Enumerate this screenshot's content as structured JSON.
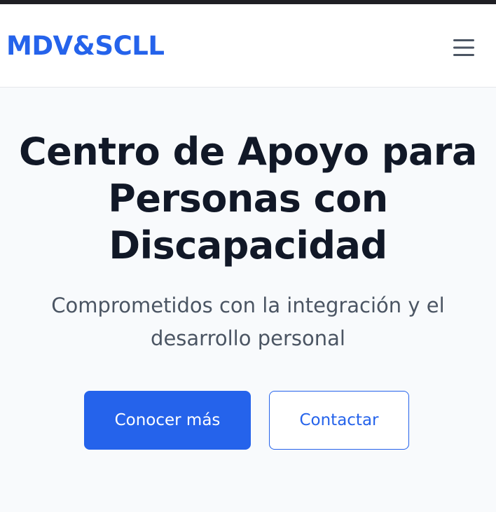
{
  "header": {
    "logo_text": "MDV&SCLL",
    "menu_icon": "hamburger-menu-icon"
  },
  "hero": {
    "title": "Centro de Apoyo para Personas con Discapacidad",
    "subtitle": "Comprometidos con la integración y el desarrollo personal",
    "primary_button_label": "Conocer más",
    "secondary_button_label": "Contactar"
  },
  "colors": {
    "brand": "#2563eb",
    "title_text": "#111827",
    "subtitle_text": "#4b5563",
    "page_background": "#f8fafc",
    "navbar_background": "#ffffff"
  }
}
